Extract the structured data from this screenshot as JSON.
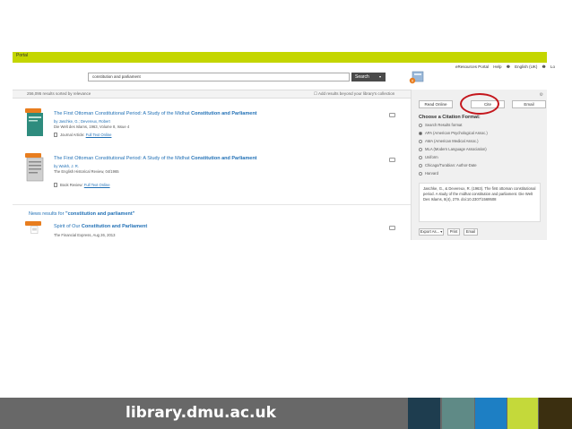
{
  "header": {
    "bar_label": "Portal"
  },
  "utility": {
    "portal": "eResources Portal",
    "help": "Help",
    "language": "English (UK)",
    "login": "Lo"
  },
  "search": {
    "query": "constitution and parliament",
    "button": "Search"
  },
  "results_header": {
    "count": "256,095 results sorted by relevance",
    "add_beyond": "Add results beyond your library's collection"
  },
  "results": [
    {
      "title_prefix": "The First Ottoman Constitutional Period: A Study of the Midhat",
      "title_match": "Constitution and Parliament",
      "author": "by Jaschke, G.; Devereux, Robert",
      "source": "Die Welt des Islams, 1963, Volume 8, Issue 4",
      "type": "Journal Article:",
      "link": "Full Text Online"
    },
    {
      "title_prefix": "The First Ottoman Constitutional Period: A Study of the Midhat",
      "title_match": "Constitution and Parliament",
      "author": "by Walsh, J. R.",
      "source": "The English Historical Review, 04/1965",
      "type": "Book Review:",
      "link": "Full Text Online"
    }
  ],
  "news": {
    "heading_prefix": "News results for",
    "heading_query": "\"constitution and parliament\"",
    "item_title_prefix": "Spirit of Our",
    "item_title_match": "Constitution and Parliament",
    "item_source": "The Financial Express, Aug 26, 2013"
  },
  "panel": {
    "tabs": [
      "Read Online",
      "Cite",
      "Email"
    ],
    "choose": "Choose a Citation Format:",
    "formats": [
      "Search Results format",
      "APA (American Psychological Assoc.)",
      "AMA (American Medical Assoc.)",
      "MLA (Modern Language Association)",
      "Uniform",
      "Chicago/Turabian: Author-Date",
      "Harvard"
    ],
    "selected_index": 1,
    "citation": "Jaschke, G., & Devereux, R. (1963). The first ottoman constitutional period. A study of the midhat constitution and parliament. Die Welt Des Islams, 8(4), 279. doi:10.2307/1569508",
    "actions": [
      "Export As...",
      "Print",
      "Email"
    ]
  },
  "footer": {
    "url": "library.dmu.ac.uk",
    "colors": [
      "#1e3d4f",
      "#5f8a86",
      "#1d7fc4",
      "#c4d93a",
      "#3b2f10"
    ]
  },
  "colors": {
    "accent_bar": "#c4d600",
    "link": "#1f6fb5",
    "tag": "#e87d1e",
    "highlight_circle": "#c4161c"
  }
}
